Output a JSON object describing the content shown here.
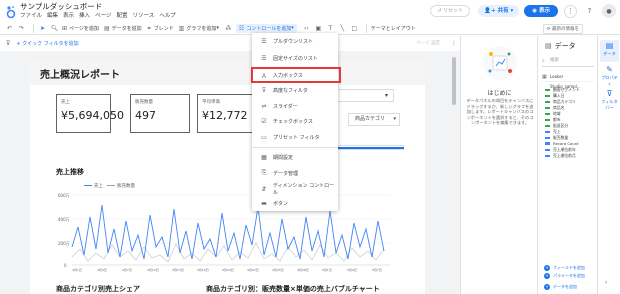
{
  "app": {
    "title": "サンプルダッシュボード",
    "menu": [
      "ファイル",
      "編集",
      "表示",
      "挿入",
      "ページ",
      "配置",
      "リソース",
      "ヘルプ"
    ],
    "reset_label": "リセット",
    "share_label": "共有",
    "view_label": "表示"
  },
  "toolbar": {
    "add_page": "ページを追加",
    "add_data": "データを追加",
    "blend": "ブレンド",
    "add_chart": "グラフを追加",
    "add_control": "コントロールを追加",
    "theme_layout": "テーマとレイアウト",
    "reorder": "最新の情報を"
  },
  "filterbar": {
    "quick_filter": "+ クイック フィルタを追加",
    "right_hint": "ページ 設定"
  },
  "menu": {
    "items": [
      "プルダウンリスト",
      "固定サイズのリスト",
      "入力ボックス",
      "高度なフィルタ",
      "スライダー",
      "チェックボックス",
      "プリセット フィルタ",
      "期間設定",
      "データ管理",
      "ディメンション コントロール",
      "ボタン"
    ]
  },
  "report": {
    "title": "売上概況レポート",
    "scorecards": [
      {
        "label": "売上",
        "value": "¥5,694,050"
      },
      {
        "label": "販売数量",
        "value": "497"
      },
      {
        "label": "平均単価",
        "value": "¥12,772"
      }
    ],
    "category_control": "商品カテゴリ",
    "trend_title": "売上推移",
    "legend": [
      "売上",
      "販売数量"
    ],
    "y_ticks": [
      "600万",
      "400万",
      "200万",
      "0"
    ],
    "share_title": "商品カテゴリ別売上シェア",
    "bubble_title": "商品カテゴリ別：販売数量×単価の売上バブルチャート"
  },
  "properties": {
    "heading": "はじめに",
    "description": "データパネルの項目をキャンバスにドラッグするか、新しいグラフを追加します。レポートキャンバスのコンポーネントを選択すると、そのコンポーネントを編集できます。"
  },
  "datapanel": {
    "title": "データ",
    "search_placeholder": "検索",
    "source": "Looker Studio_sampl...",
    "fields": [
      "顧客セグメント",
      "購入日",
      "商品カテゴリ",
      "商品名",
      "地域",
      "都市",
      "配送区分",
      "売上",
      "販売数量",
      "Record Count",
      "売上順位前年",
      "売上順位前月"
    ],
    "add_field": "フィールドを追加",
    "add_param": "パラメータを追加",
    "add_data": "データを追加"
  },
  "sidetabs": [
    "データ",
    "プロパティ",
    "フィルタ バー"
  ],
  "colors": {
    "accent": "#1a73e8",
    "highlight": "#e53935",
    "series1": "#4285f4",
    "series2": "#9aa0a6"
  }
}
